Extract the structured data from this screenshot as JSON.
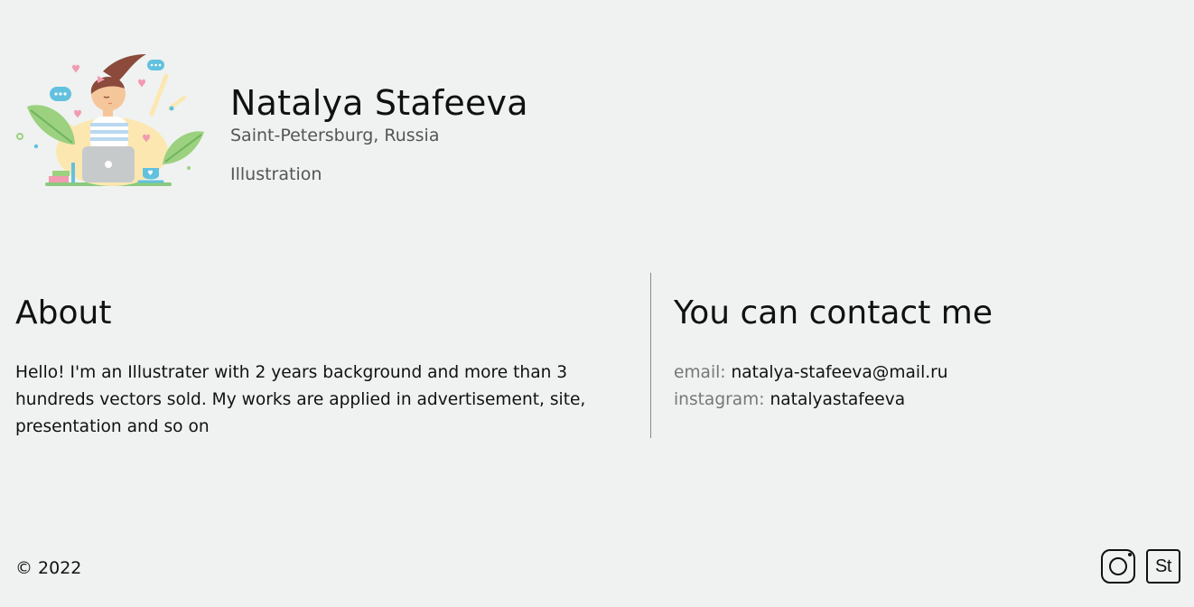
{
  "profile": {
    "name": "Natalya Stafeeva",
    "location": "Saint-Petersburg, Russia",
    "field": "Illustration"
  },
  "about": {
    "title": "About",
    "text": "Hello! I'm an Illustrater with 2 years background and more than 3 hundreds vectors sold. My works are applied in advertisement, site, presentation and so on"
  },
  "contact": {
    "title": "You can contact me",
    "email_label": "email:",
    "email_value": "natalya-stafeeva@mail.ru",
    "instagram_label": "instagram:",
    "instagram_value": "natalyastafeeva"
  },
  "footer": {
    "copyright": "© 2022",
    "social": [
      {
        "icon": "instagram-icon"
      },
      {
        "icon": "behance-icon",
        "text": "St"
      }
    ]
  },
  "colors": {
    "background": "#eff2f1",
    "text": "#111111",
    "muted": "#777777",
    "divider": "#8a8a8a"
  }
}
